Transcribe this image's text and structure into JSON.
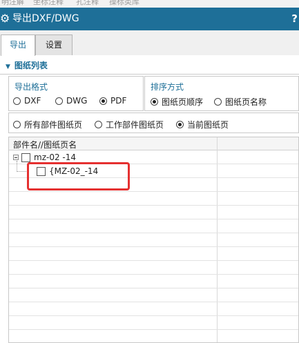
{
  "top_strip": [
    "明注解",
    "坐标注释",
    "孔注释",
    "操标类库"
  ],
  "window": {
    "title": "导出DXF/DWG",
    "help_label": "?"
  },
  "tabs": [
    {
      "label": "导出",
      "active": true
    },
    {
      "label": "设置",
      "active": false
    }
  ],
  "section": {
    "title": "图纸列表"
  },
  "export_format": {
    "title": "导出格式",
    "options": [
      {
        "label": "DXF",
        "selected": false
      },
      {
        "label": "DWG",
        "selected": false
      },
      {
        "label": "PDF",
        "selected": true
      }
    ]
  },
  "sort_method": {
    "title": "排序方式",
    "options": [
      {
        "label": "图纸页顺序",
        "selected": true
      },
      {
        "label": "图纸页名称",
        "selected": false
      }
    ]
  },
  "scope": {
    "options": [
      {
        "label": "所有部件图纸页",
        "selected": false
      },
      {
        "label": "工作部件图纸页",
        "selected": false
      },
      {
        "label": "当前图纸页",
        "selected": true
      }
    ]
  },
  "grid": {
    "column_header": "部件名//图纸页名",
    "tree": [
      {
        "label": "mz-02 -14",
        "level": 0,
        "checked": false,
        "expanded": true
      },
      {
        "label": "{MZ-02_-14",
        "level": 1,
        "checked": false
      }
    ]
  },
  "colors": {
    "accent": "#1e6f98",
    "highlight": "#e53030"
  }
}
